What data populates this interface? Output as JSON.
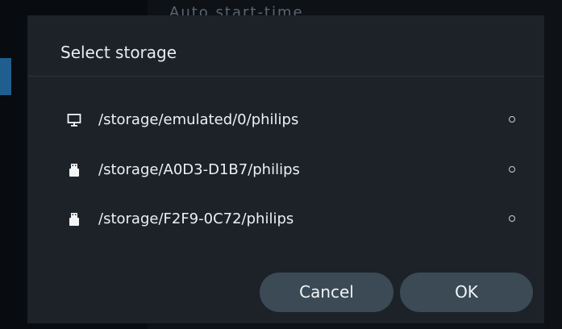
{
  "background": {
    "title": "Auto start-time"
  },
  "dialog": {
    "title": "Select storage",
    "options": [
      {
        "icon": "monitor-icon",
        "path": "/storage/emulated/0/philips",
        "selected": false
      },
      {
        "icon": "usb-drive-icon",
        "path": "/storage/A0D3-D1B7/philips",
        "selected": false
      },
      {
        "icon": "usb-drive-icon",
        "path": "/storage/F2F9-0C72/philips",
        "selected": false
      }
    ],
    "buttons": {
      "cancel": "Cancel",
      "ok": "OK"
    }
  },
  "colors": {
    "dialog_bg": "#1d2228",
    "button_bg": "#3b4a55",
    "accent": "#1f5e8e",
    "text": "#eef0f2"
  }
}
